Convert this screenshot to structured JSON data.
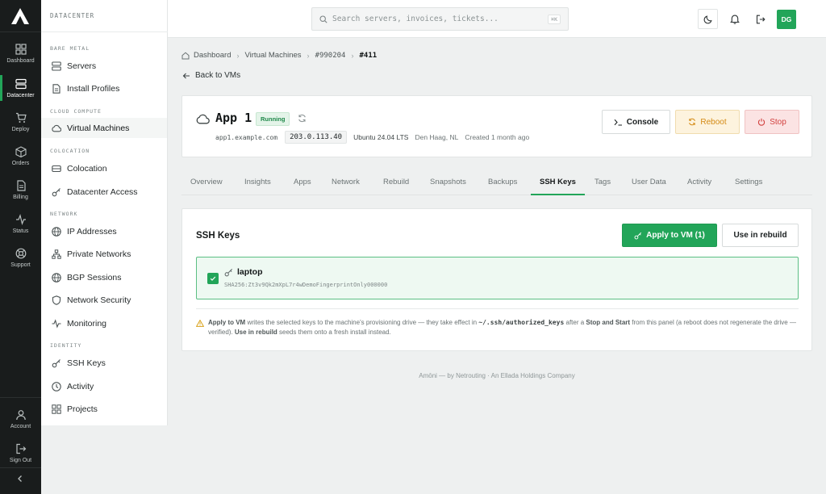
{
  "rail": {
    "items": [
      {
        "label": "Dashboard",
        "icon": "dashboard-icon"
      },
      {
        "label": "Datacenter",
        "icon": "server-icon"
      },
      {
        "label": "Deploy",
        "icon": "cart-icon"
      },
      {
        "label": "Orders",
        "icon": "box-icon"
      },
      {
        "label": "Billing",
        "icon": "document-icon"
      },
      {
        "label": "Status",
        "icon": "pulse-icon"
      },
      {
        "label": "Support",
        "icon": "lifebuoy-icon"
      }
    ],
    "active": "Datacenter",
    "account_label": "Account",
    "signout_label": "Sign Out"
  },
  "sidebar": {
    "heading": "DATACENTER",
    "sections": {
      "bare_metal": "BARE METAL",
      "cloud_compute": "CLOUD COMPUTE",
      "colocation": "COLOCATION",
      "network": "NETWORK",
      "identity": "IDENTITY"
    },
    "items": {
      "servers": "Servers",
      "install_profiles": "Install Profiles",
      "virtual_machines": "Virtual Machines",
      "colocation": "Colocation",
      "datacenter_access": "Datacenter Access",
      "ip_addresses": "IP Addresses",
      "private_networks": "Private Networks",
      "bgp_sessions": "BGP Sessions",
      "network_security": "Network Security",
      "monitoring": "Monitoring",
      "ssh_keys": "SSH Keys",
      "activity": "Activity",
      "projects": "Projects"
    },
    "active": "Virtual Machines"
  },
  "topbar": {
    "search_placeholder": "Search servers, invoices, tickets...",
    "search_shortcut": "⌘K",
    "avatar_initials": "DG"
  },
  "breadcrumb": {
    "dashboard": "Dashboard",
    "virtual_machines": "Virtual Machines",
    "order": "#990204",
    "current": "#411"
  },
  "back_label": "Back to VMs",
  "vm": {
    "name": "App 1",
    "status": "Running",
    "hostname": "app1.example.com",
    "ip": "203.0.113.40",
    "os": "Ubuntu 24.04 LTS",
    "location": "Den Haag, NL",
    "created": "Created 1 month ago",
    "actions": {
      "console": "Console",
      "reboot": "Reboot",
      "stop": "Stop"
    }
  },
  "tabs": [
    "Overview",
    "Insights",
    "Apps",
    "Network",
    "Rebuild",
    "Snapshots",
    "Backups",
    "SSH Keys",
    "Tags",
    "User Data",
    "Activity",
    "Settings"
  ],
  "active_tab": "SSH Keys",
  "ssh": {
    "title": "SSH Keys",
    "apply_label": "Apply to VM (1)",
    "rebuild_label": "Use in rebuild",
    "keys": [
      {
        "name": "laptop",
        "fingerprint": "SHA256:Zt3v9Qk2mXpL7r4wDemoFingerprintOnly000000",
        "selected": true
      }
    ],
    "note": {
      "p1": "Apply to VM",
      "p2": " writes the selected keys to the machine's provisioning drive — they take effect in ",
      "p3": "~/.ssh/authorized_keys",
      "p4": " after a ",
      "p5": "Stop and Start",
      "p6": " from this panel (a reboot does not regenerate the drive — verified). ",
      "p7": "Use in rebuild",
      "p8": " seeds them onto a fresh install instead."
    }
  },
  "footer": "Amōni — by Netrouting · An Ellada Holdings Company",
  "colors": {
    "accent": "#22a559",
    "warning": "#d48a14",
    "danger": "#d2413f",
    "rail": "#191c1c"
  }
}
